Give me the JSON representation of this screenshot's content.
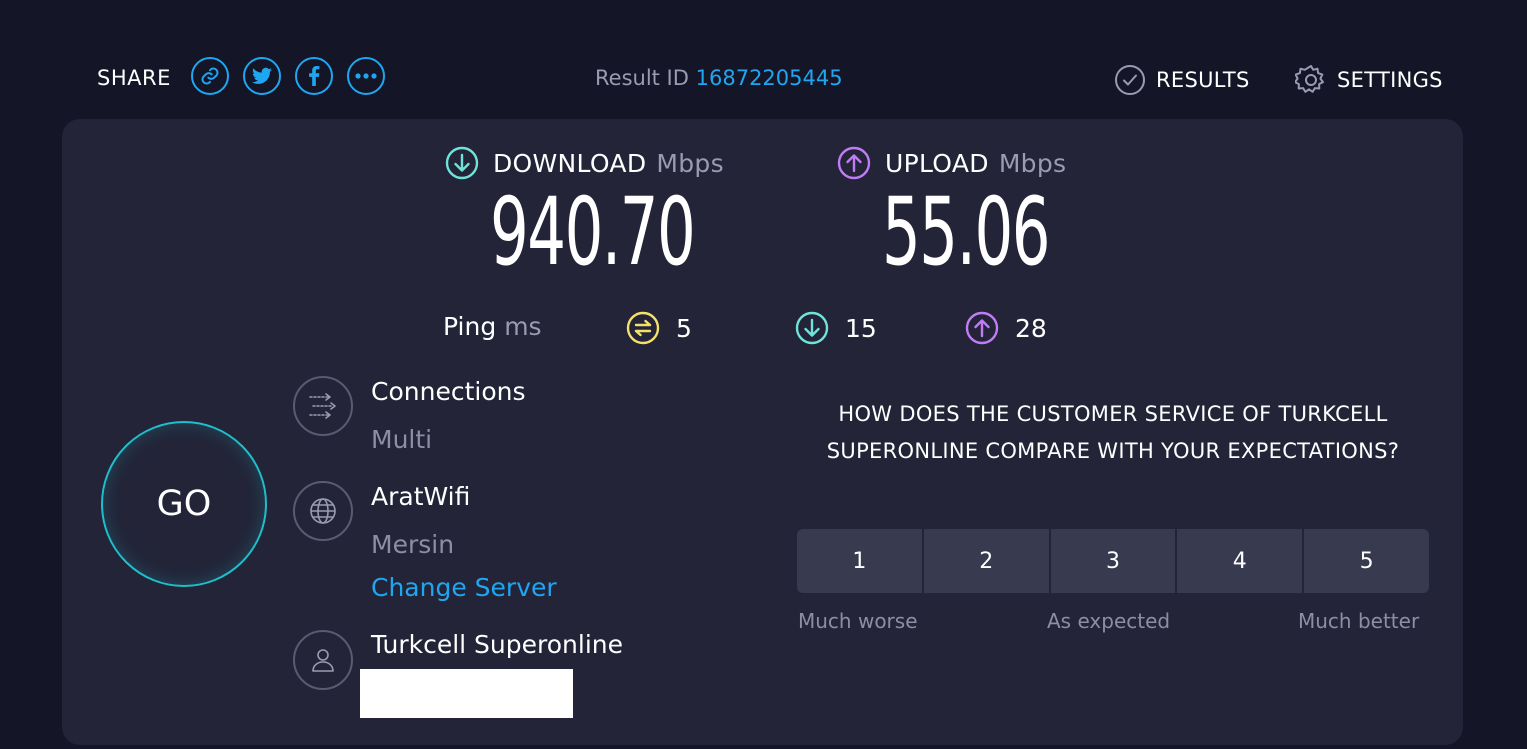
{
  "header": {
    "share_label": "SHARE",
    "share_buttons": [
      "link-icon",
      "twitter-icon",
      "facebook-icon",
      "more-icon"
    ],
    "result_id_label": "Result ID",
    "result_id": "16872205445",
    "results_label": "RESULTS",
    "settings_label": "SETTINGS"
  },
  "download": {
    "label": "DOWNLOAD",
    "unit": "Mbps",
    "value": "940.70",
    "color": "#6fe3d9"
  },
  "upload": {
    "label": "UPLOAD",
    "unit": "Mbps",
    "value": "55.06",
    "color": "#c17cf5"
  },
  "ping": {
    "label": "Ping",
    "unit": "ms",
    "idle": "5",
    "download": "15",
    "upload": "28",
    "idle_color": "#f4e06a"
  },
  "go_label": "GO",
  "connections": {
    "title": "Connections",
    "value": "Multi"
  },
  "server": {
    "name": "AratWifi",
    "location": "Mersin",
    "change_label": "Change Server"
  },
  "provider": {
    "name": "Turkcell Superonline"
  },
  "survey": {
    "question": "HOW DOES THE CUSTOMER SERVICE OF TURKCELL SUPERONLINE COMPARE WITH YOUR EXPECTATIONS?",
    "options": [
      "1",
      "2",
      "3",
      "4",
      "5"
    ],
    "low_label": "Much worse",
    "mid_label": "As expected",
    "high_label": "Much better"
  },
  "colors": {
    "accent": "#1fa6f1",
    "background": "#141526",
    "card": "#232438"
  }
}
